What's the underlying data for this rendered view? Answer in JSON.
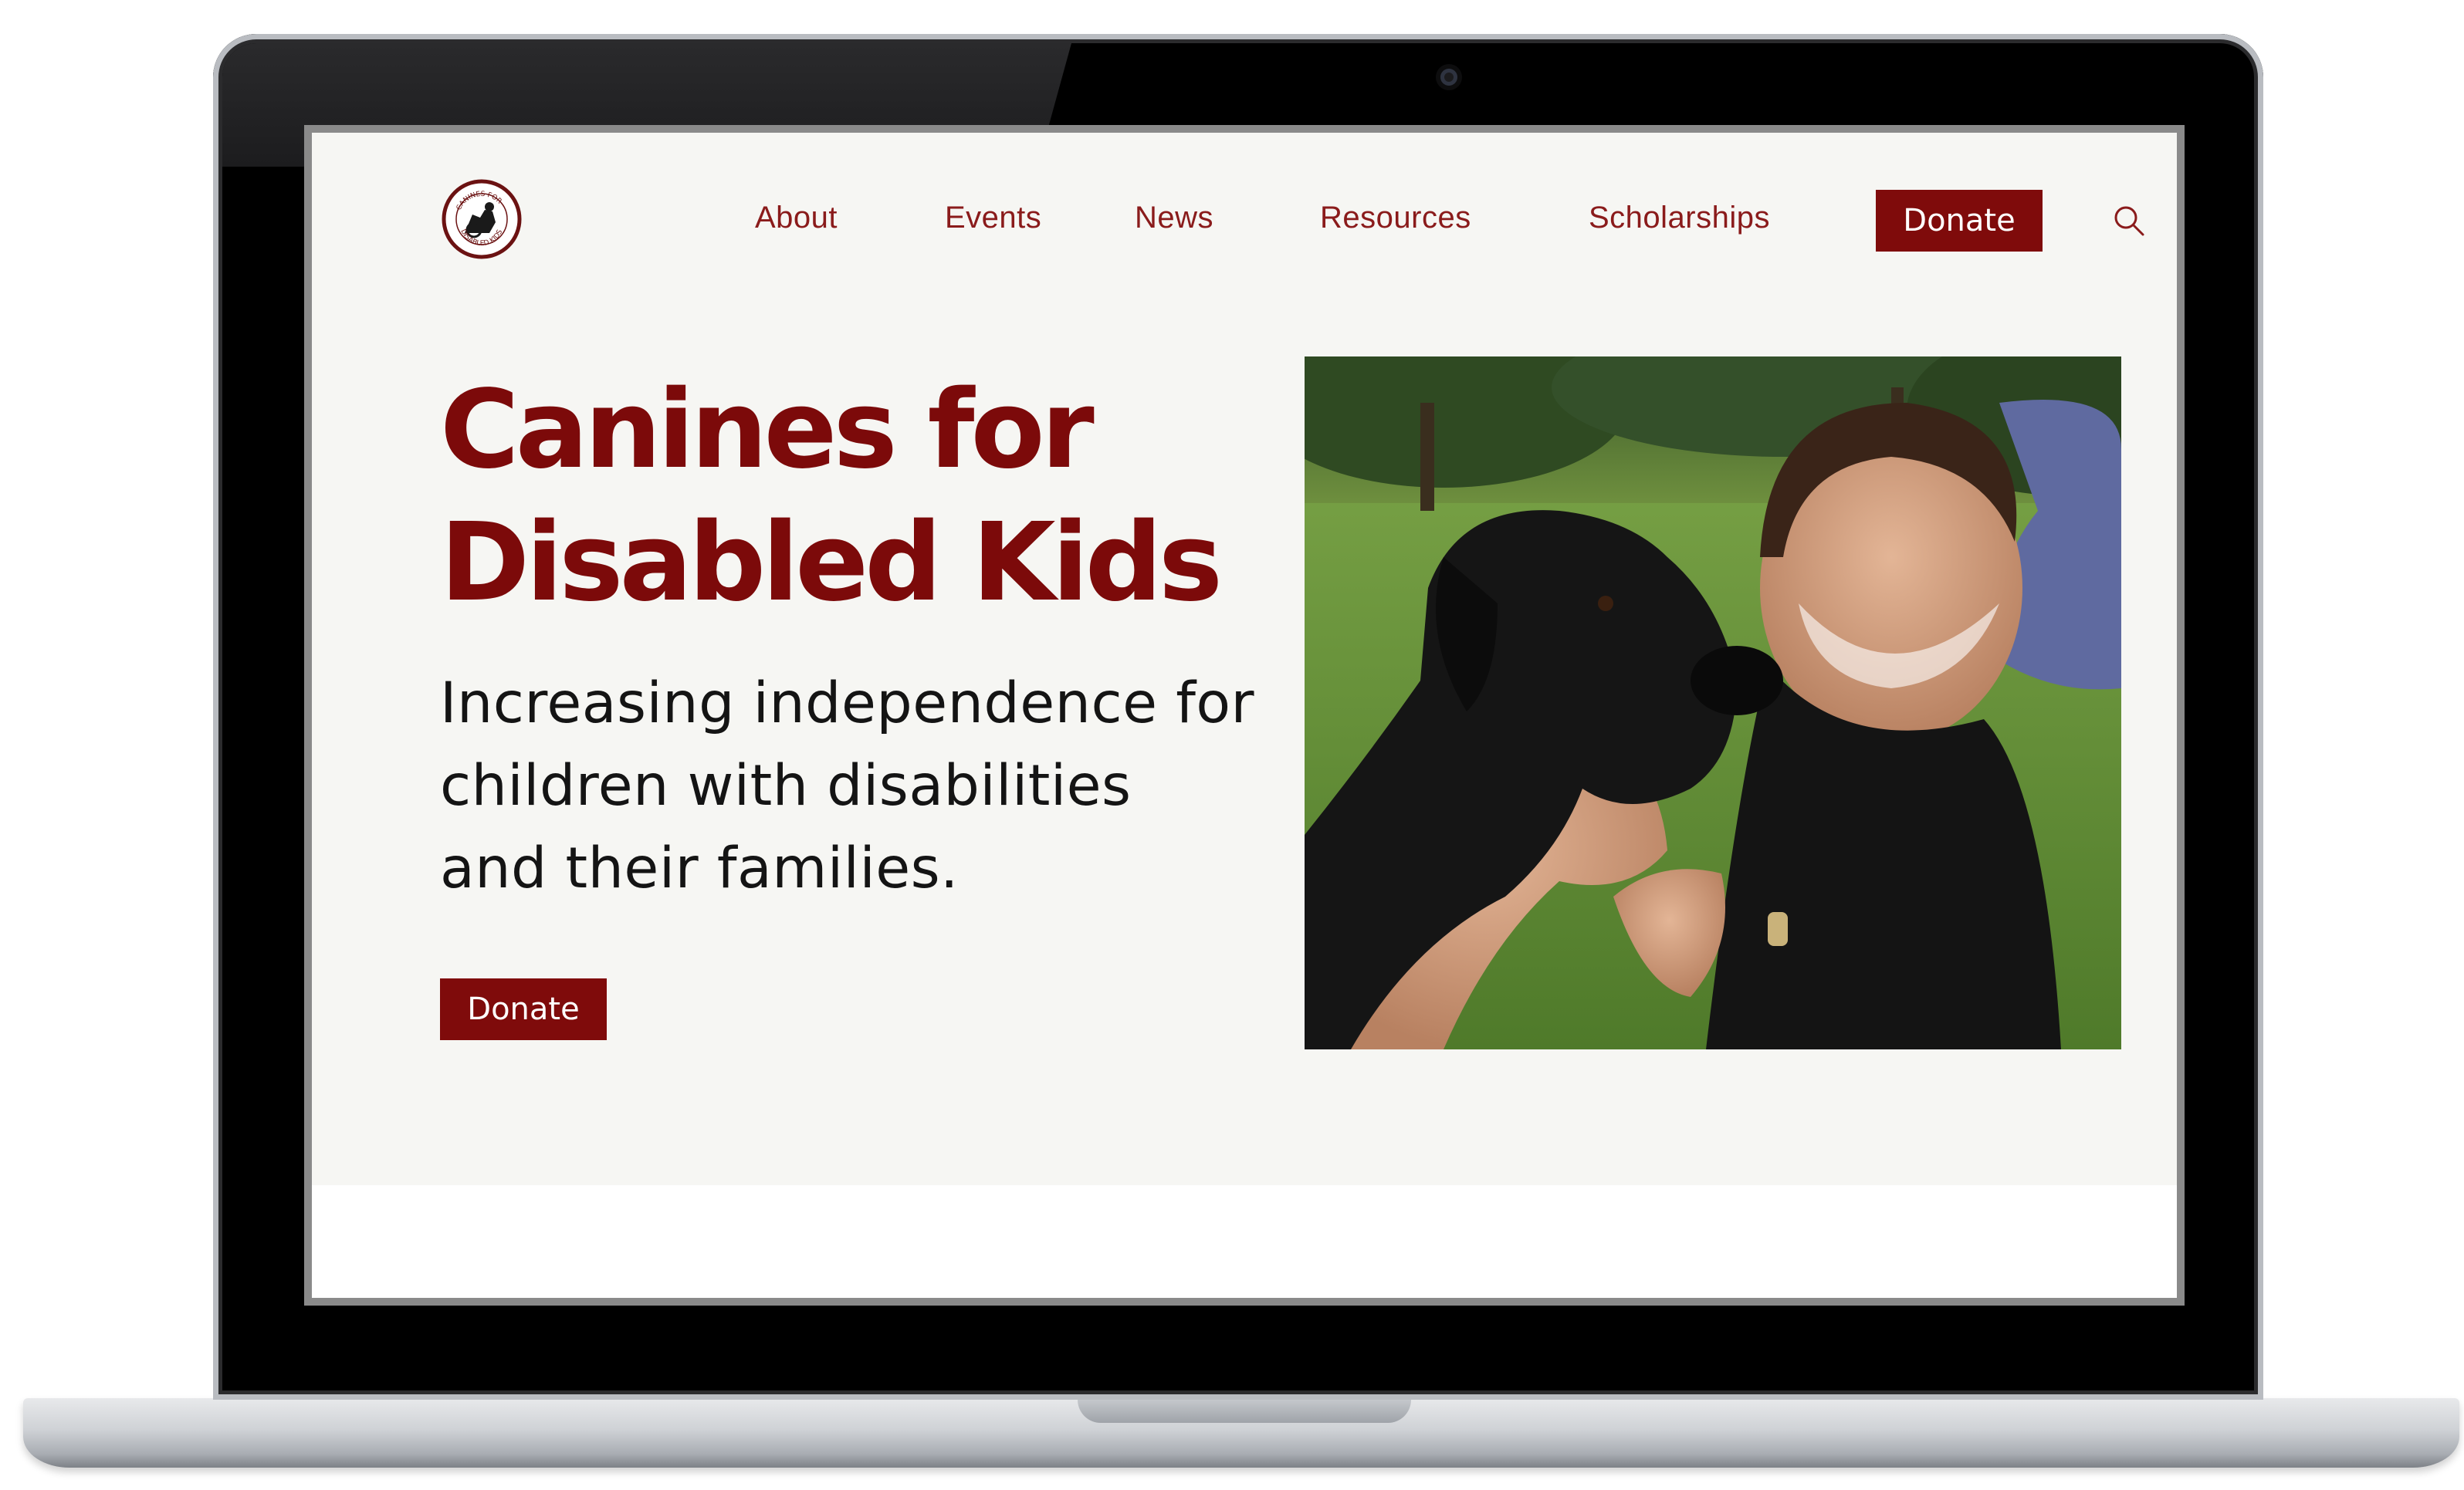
{
  "site": {
    "logo_icon": "canines-for-disabled-kids-logo",
    "logo_text": "CANINES FOR DISABLED KIDS",
    "accent_color": "#7f0b0b",
    "background_color": "#f6f6f3"
  },
  "nav": {
    "items": [
      {
        "label": "About"
      },
      {
        "label": "Events"
      },
      {
        "label": "News"
      },
      {
        "label": "Resources"
      },
      {
        "label": "Scholarships"
      }
    ],
    "donate_label": "Donate",
    "search_icon": "search-icon"
  },
  "hero": {
    "title_line1": "Canines for",
    "title_line2": "Disabled Kids",
    "tagline_line1": "Increasing independence for",
    "tagline_line2": "children with disabilities",
    "tagline_line3": "and their families.",
    "donate_label": "Donate",
    "photo_subject": "girl-hugging-black-dog-photo"
  }
}
